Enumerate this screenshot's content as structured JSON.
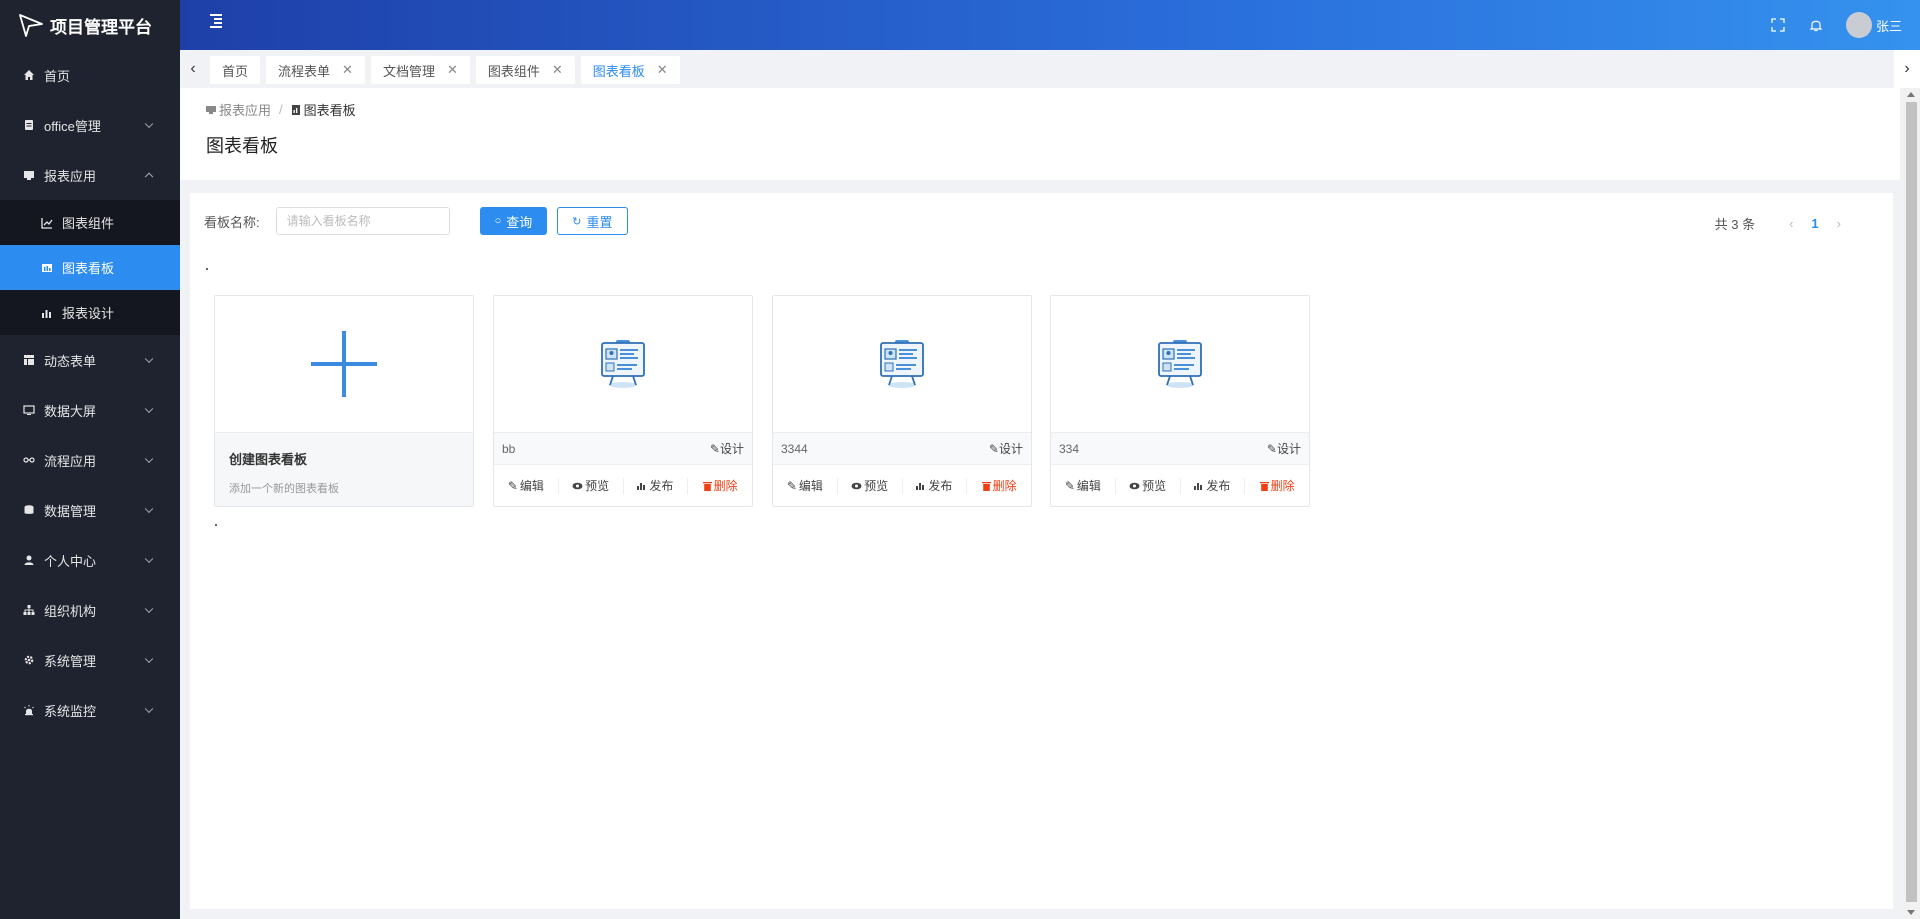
{
  "app": {
    "title": "项目管理平台"
  },
  "sidebar": {
    "items": [
      {
        "label": "首页",
        "icon": "home-icon"
      },
      {
        "label": "office管理",
        "icon": "document-icon"
      },
      {
        "label": "报表应用",
        "icon": "report-icon"
      },
      {
        "label": "动态表单",
        "icon": "table-icon"
      },
      {
        "label": "数据大屏",
        "icon": "monitor-icon"
      },
      {
        "label": "流程应用",
        "icon": "flow-icon"
      },
      {
        "label": "数据管理",
        "icon": "database-icon"
      },
      {
        "label": "个人中心",
        "icon": "user-icon"
      },
      {
        "label": "组织机构",
        "icon": "org-icon"
      },
      {
        "label": "系统管理",
        "icon": "gear-icon"
      },
      {
        "label": "系统监控",
        "icon": "alarm-icon"
      }
    ],
    "submenu": [
      {
        "label": "图表组件",
        "icon": "line-chart-icon"
      },
      {
        "label": "图表看板",
        "icon": "dashboard-icon",
        "active": true
      },
      {
        "label": "报表设计",
        "icon": "bar-chart-icon"
      }
    ]
  },
  "header": {
    "user_name": "张三",
    "icons": [
      "fullscreen-icon",
      "bell-icon"
    ]
  },
  "tabs": [
    {
      "label": "首页",
      "closable": false
    },
    {
      "label": "流程表单",
      "closable": true
    },
    {
      "label": "文档管理",
      "closable": true
    },
    {
      "label": "图表组件",
      "closable": true
    },
    {
      "label": "图表看板",
      "closable": true,
      "active": true
    }
  ],
  "breadcrumb": {
    "parent": "报表应用",
    "separator": "/",
    "current": "图表看板"
  },
  "page": {
    "title": "图表看板"
  },
  "filter": {
    "label": "看板名称:",
    "placeholder": "请输入看板名称",
    "value": "",
    "search_label": "查询",
    "reset_label": "重置"
  },
  "pagination": {
    "total_text": "共 3 条",
    "current_page": "1"
  },
  "create_card": {
    "title": "创建图表看板",
    "subtitle": "添加一个新的图表看板"
  },
  "boards": [
    {
      "name": "bb"
    },
    {
      "name": "3344"
    },
    {
      "name": "334"
    }
  ],
  "card_actions": {
    "design": "设计",
    "edit": "编辑",
    "preview": "预览",
    "publish": "发布",
    "delete": "删除"
  },
  "colors": {
    "sidebar_bg": "#1f2330",
    "accent": "#2d8cf0",
    "danger": "#ed4014",
    "header_start": "#1e3fa8",
    "header_end": "#3592ee"
  }
}
